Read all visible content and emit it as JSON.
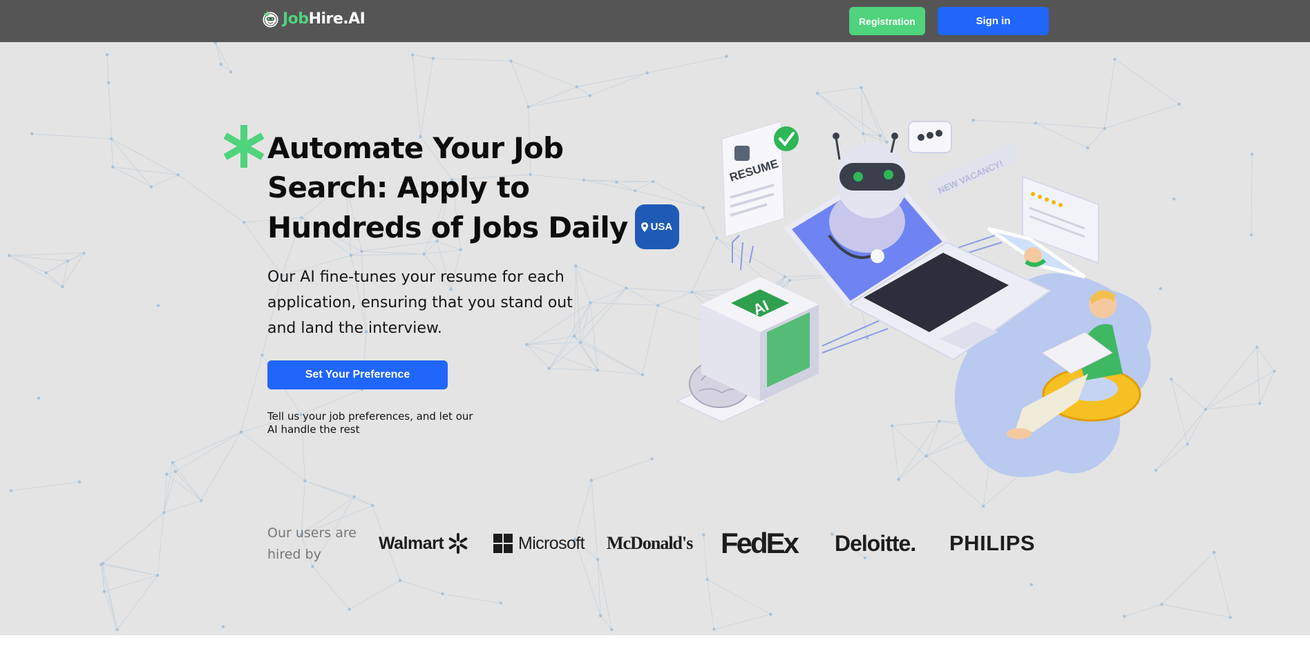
{
  "header": {
    "logo_job": "Job",
    "logo_rest": "Hire.AI",
    "registration_label": "Registration",
    "signin_label": "Sign in"
  },
  "hero": {
    "headline": "Automate Your Job Search: Apply to Hundreds of Jobs Daily",
    "badge_label": "USA",
    "subtext": "Our AI fine-tunes your resume for each application, ensuring that you stand out and land the interview.",
    "cta_label": "Set Your Preference",
    "cta_note": "Tell us your job preferences, and let our AI handle the rest"
  },
  "illustration": {
    "resume_label": "RESUME",
    "ai_label": "AI",
    "vacancy_label": "NEW VACANCY!"
  },
  "hired_by": {
    "label": "Our users are hired by",
    "brands": [
      "Walmart",
      "Microsoft",
      "McDonald's",
      "FedEx",
      "Deloitte.",
      "PHILIPS"
    ]
  },
  "colors": {
    "header_bg": "#555555",
    "accent_green": "#4fd37d",
    "primary_blue": "#2166fb",
    "hero_bg": "#e4e4e4"
  }
}
